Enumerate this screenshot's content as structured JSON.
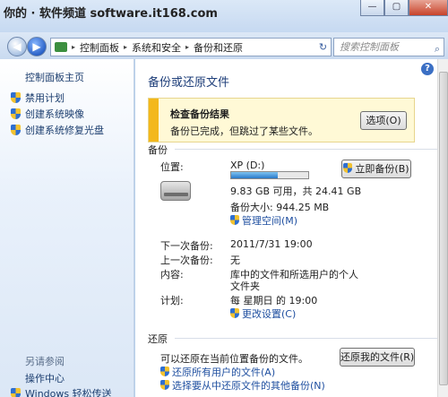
{
  "watermark": "你的 · 软件频道 software.it168.com",
  "window_controls": {
    "minimize": "—",
    "maximize": "▢",
    "close": "✕"
  },
  "address": {
    "crumbs": [
      "控制面板",
      "系统和安全",
      "备份和还原"
    ],
    "separator": "▸",
    "refresh_icon": "↻",
    "search_placeholder": "搜索控制面板",
    "search_icon": "⌕"
  },
  "sidebar": {
    "home_label": "控制面板主页",
    "items": [
      {
        "label": "禁用计划",
        "icon": "uac-shield-icon"
      },
      {
        "label": "创建系统映像",
        "icon": "uac-shield-icon"
      },
      {
        "label": "创建系统修复光盘",
        "icon": "uac-shield-icon"
      }
    ],
    "see_also_heading": "另请参阅",
    "see_also": [
      {
        "label": "操作中心"
      },
      {
        "label": "Windows 轻松传送",
        "icon": "uac-shield-icon"
      }
    ]
  },
  "main": {
    "help_icon": "?",
    "title": "备份或还原文件",
    "notice": {
      "title": "检查备份结果",
      "message": "备份已完成，但跳过了某些文件。",
      "options_button": "选项(O)"
    },
    "backup": {
      "section_label": "备份",
      "location_key": "位置:",
      "location_value": "XP (D:)",
      "used_fraction": 0.6,
      "space_text": "9.83 GB 可用，共 24.41 GB",
      "backup_size": "备份大小: 944.25 MB",
      "manage_space_link": "管理空间(M)",
      "backup_now_button": "立即备份(B)",
      "next_key": "下一次备份:",
      "next_value": "2011/7/31 19:00",
      "last_key": "上一次备份:",
      "last_value": "无",
      "content_key": "内容:",
      "content_value_line1": "库中的文件和所选用户的个人",
      "content_value_line2": "文件夹",
      "schedule_key": "计划:",
      "schedule_value": "每 星期日 的 19:00",
      "change_settings_link": "更改设置(C)"
    },
    "restore": {
      "section_label": "还原",
      "text": "可以还原在当前位置备份的文件。",
      "restore_files_button": "还原我的文件(R)",
      "all_users_link": "还原所有用户的文件(A)",
      "other_backup_link": "选择要从中还原文件的其他备份(N)"
    }
  }
}
